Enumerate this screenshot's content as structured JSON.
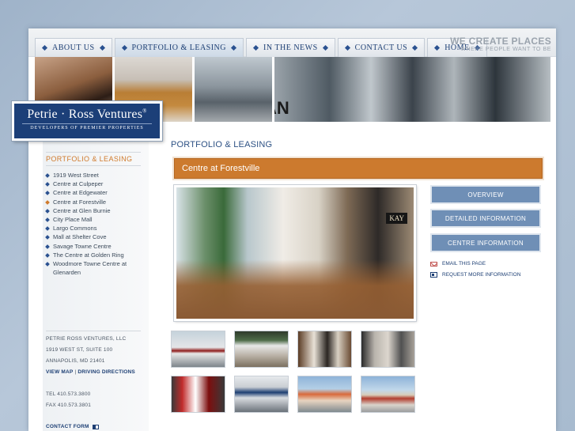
{
  "nav": {
    "tabs": [
      {
        "label": "ABOUT US"
      },
      {
        "label": "PORTFOLIO & LEASING",
        "active": true
      },
      {
        "label": "IN THE NEWS"
      },
      {
        "label": "CONTACT US"
      },
      {
        "label": "HOME"
      }
    ],
    "tagline_big": "WE CREATE PLACES",
    "tagline_small": "WHERE PEOPLE WANT TO BE"
  },
  "logo": {
    "name": "Petrie · Ross Ventures",
    "registered": "®",
    "subtitle": "DEVELOPERS OF PREMIER PROPERTIES"
  },
  "banner": {
    "sign_text": "LAN"
  },
  "sidebar": {
    "heading": "PORTFOLIO & LEASING",
    "items": [
      {
        "label": "1919 West Street"
      },
      {
        "label": "Centre at Culpeper"
      },
      {
        "label": "Centre at Edgewater"
      },
      {
        "label": "Centre at Forestville",
        "active": true
      },
      {
        "label": "Centre at Glen Burnie"
      },
      {
        "label": "City Place Mall"
      },
      {
        "label": "Largo Commons"
      },
      {
        "label": "Mall at Shelter Cove"
      },
      {
        "label": "Savage Towne Centre"
      },
      {
        "label": "The Centre at Golden Ring"
      },
      {
        "label": "Woodmore Towne Centre at Glenarden"
      }
    ],
    "company": "PETRIE ROSS VENTURES, LLC",
    "address1": "1919 WEST ST, SUITE 100",
    "address2": "ANNAPOLIS, MD 21401",
    "view_map": "VIEW MAP",
    "separator": "|",
    "driving_directions": "DRIVING DIRECTIONS",
    "tel": "TEL  410.573.3800",
    "fax": "FAX  410.573.3801",
    "contact_form": "CONTACT FORM"
  },
  "main": {
    "page_title": "PORTFOLIO & LEASING",
    "property_title": "Centre at Forestville",
    "photo_sign": "KAY",
    "buttons": {
      "overview": "OVERVIEW",
      "detailed": "DETAILED INFORMATION",
      "centre": "CENTRE INFORMATION"
    },
    "email_link": "EMAIL THIS PAGE",
    "request_link": "REQUEST MORE INFORMATION"
  },
  "colors": {
    "accent_orange": "#cc7a2e",
    "navy": "#1c3f78",
    "button_blue": "#6f8fb6"
  }
}
